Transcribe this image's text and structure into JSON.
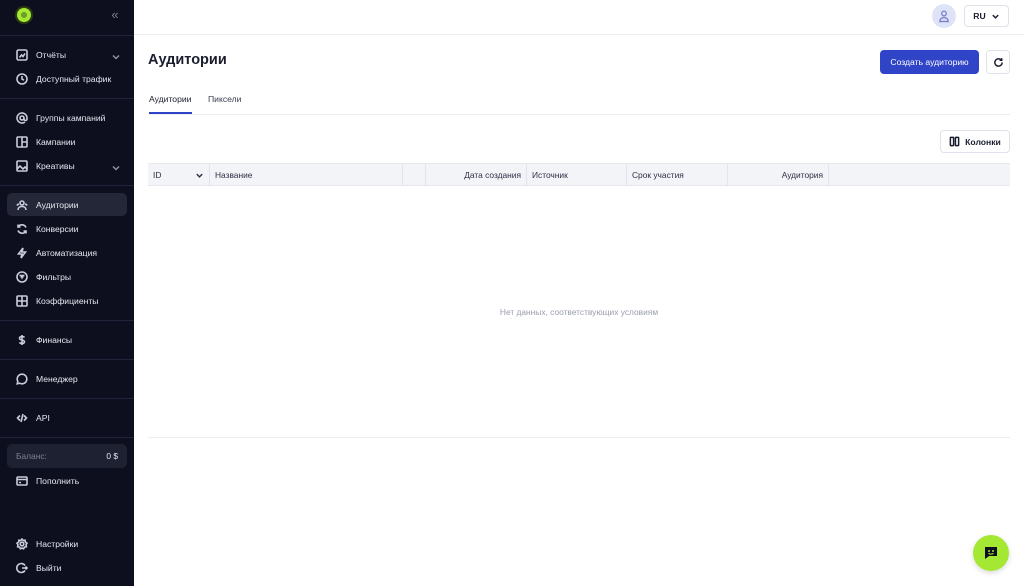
{
  "brand": {
    "accent": "#a4e834",
    "primary": "#3044c8",
    "sidebar_bg": "#0d0f1e"
  },
  "sidebar": {
    "items": [
      {
        "label": "Отчёты",
        "icon": "chart-icon",
        "has_chevron": true
      },
      {
        "label": "Доступный трафик",
        "icon": "clock-icon",
        "has_chevron": false
      },
      {
        "label": "Группы кампаний",
        "icon": "at-icon",
        "has_chevron": false
      },
      {
        "label": "Кампании",
        "icon": "layout-icon",
        "has_chevron": false
      },
      {
        "label": "Креативы",
        "icon": "image-icon",
        "has_chevron": true
      },
      {
        "label": "Аудитории",
        "icon": "users-icon",
        "has_chevron": false,
        "active": true
      },
      {
        "label": "Конверсии",
        "icon": "refresh-icon",
        "has_chevron": false
      },
      {
        "label": "Автоматизация",
        "icon": "bolt-icon",
        "has_chevron": false
      },
      {
        "label": "Фильтры",
        "icon": "filter-icon",
        "has_chevron": false
      },
      {
        "label": "Коэффициенты",
        "icon": "grid-icon",
        "has_chevron": false
      },
      {
        "label": "Финансы",
        "icon": "dollar-icon",
        "has_chevron": false
      },
      {
        "label": "Менеджер",
        "icon": "chat-icon",
        "has_chevron": false
      },
      {
        "label": "API",
        "icon": "code-icon",
        "has_chevron": false
      },
      {
        "label": "Пополнить",
        "icon": "wallet-icon",
        "has_chevron": false
      },
      {
        "label": "Настройки",
        "icon": "settings-icon",
        "has_chevron": false
      },
      {
        "label": "Выйти",
        "icon": "logout-icon",
        "has_chevron": false
      }
    ],
    "balance": {
      "label": "Баланс:",
      "value": "0 $"
    }
  },
  "topbar": {
    "language": "RU"
  },
  "main": {
    "title": "Аудитории",
    "create_button": "Создать аудиторию",
    "tabs": [
      {
        "label": "Аудитории",
        "active": true
      },
      {
        "label": "Пиксели",
        "active": false
      }
    ],
    "columns_button": "Колонки",
    "table": {
      "headers": [
        "ID",
        "Название",
        "",
        "Дата создания",
        "Источник",
        "Срок участия",
        "Аудитория",
        ""
      ],
      "rows": [],
      "empty_text": "Нет данных, соответствующих условиям"
    }
  }
}
